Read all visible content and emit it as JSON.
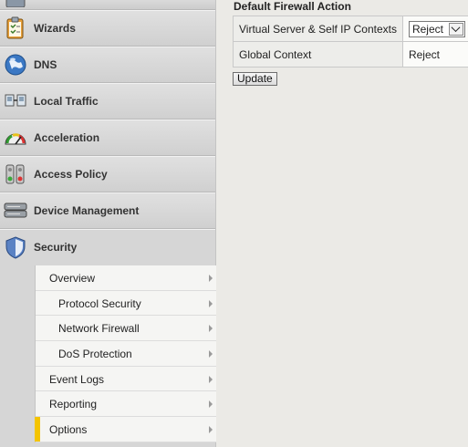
{
  "nav": {
    "items": [
      {
        "label": "Wizards",
        "icon": "clipboard-checklist-icon"
      },
      {
        "label": "DNS",
        "icon": "globe-icon"
      },
      {
        "label": "Local Traffic",
        "icon": "network-icon"
      },
      {
        "label": "Acceleration",
        "icon": "speedometer-icon"
      },
      {
        "label": "Access Policy",
        "icon": "traffic-lights-icon"
      },
      {
        "label": "Device Management",
        "icon": "server-icon"
      },
      {
        "label": "Security",
        "icon": "shield-icon"
      }
    ],
    "security_submenu": [
      {
        "label": "Overview"
      },
      {
        "label": "Protocol Security"
      },
      {
        "label": "Network Firewall"
      },
      {
        "label": "DoS Protection"
      },
      {
        "label": "Event Logs"
      },
      {
        "label": "Reporting"
      },
      {
        "label": "Options"
      }
    ]
  },
  "main": {
    "section_title": "Default Firewall Action",
    "rows": [
      {
        "name": "Virtual Server & Self IP Contexts",
        "value": "Reject"
      },
      {
        "name": "Global Context",
        "value": "Reject"
      }
    ],
    "update_label": "Update"
  },
  "colors": {
    "nav_bg": "#d6d6d6",
    "content_bg": "#ebeae6",
    "selected_marker": "#f4c400"
  }
}
